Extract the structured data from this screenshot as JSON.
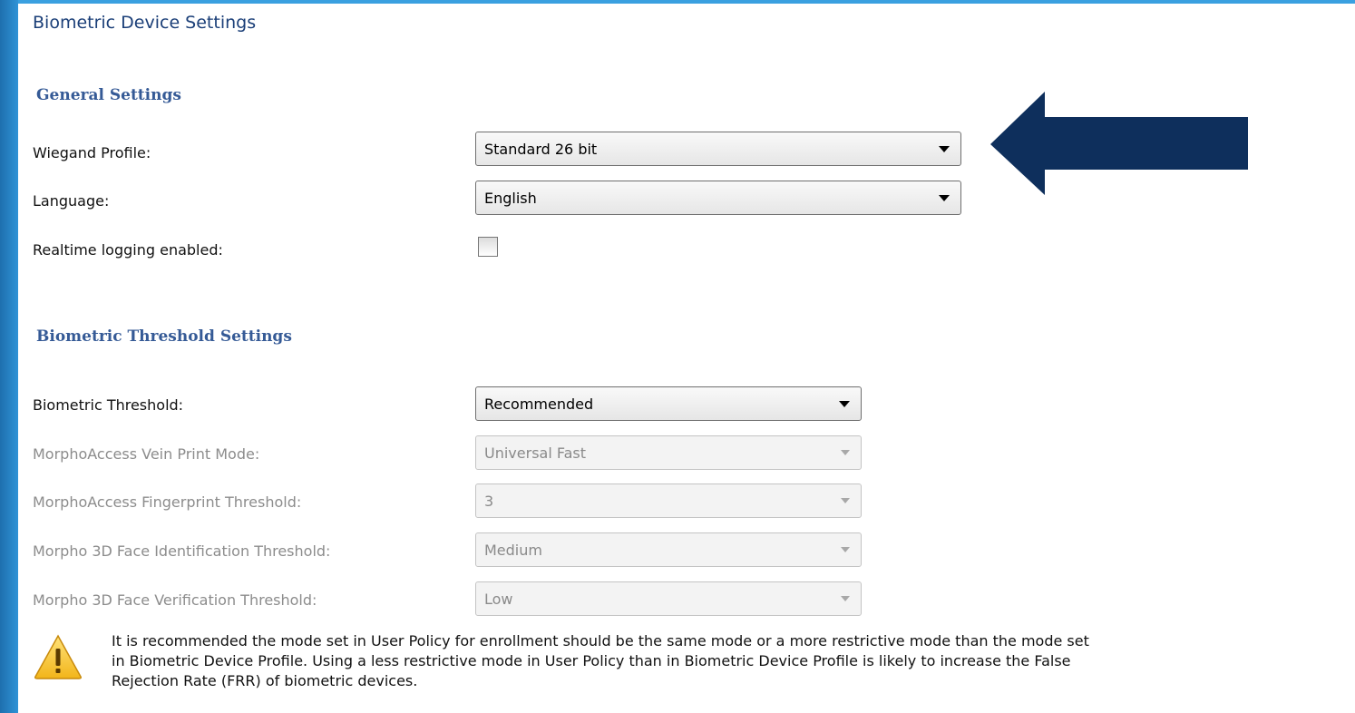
{
  "page": {
    "title": "Biometric Device Settings",
    "accent_color": "#1b3f78",
    "section_color": "#355a96",
    "background_color": "#2a8fd0",
    "arrow_color": "#0e2f5c"
  },
  "general": {
    "title": "General Settings",
    "wiegand_label": "Wiegand Profile:",
    "wiegand_value": "Standard 26 bit",
    "language_label": "Language:",
    "language_value": "English",
    "realtime_label": "Realtime logging enabled:",
    "realtime_checked": false
  },
  "threshold": {
    "title": "Biometric Threshold Settings",
    "biometric_label": "Biometric Threshold:",
    "biometric_value": "Recommended",
    "vein_label": "MorphoAccess Vein Print Mode:",
    "vein_value": "Universal Fast",
    "fingerprint_label": "MorphoAccess Fingerprint Threshold:",
    "fingerprint_value": "3",
    "face_id_label": "Morpho 3D Face Identification Threshold:",
    "face_id_value": "Medium",
    "face_verify_label": "Morpho 3D Face Verification Threshold:",
    "face_verify_value": "Low"
  },
  "warning": {
    "icon": "warning-icon",
    "line1": "It is recommended the mode set in User Policy for enrollment should be the same mode or a more restrictive mode than the mode set",
    "line2": "in Biometric Device Profile.  Using a less restrictive mode in User Policy than in Biometric Device Profile is likely to increase the False",
    "line3": "Rejection Rate (FRR) of biometric devices."
  }
}
